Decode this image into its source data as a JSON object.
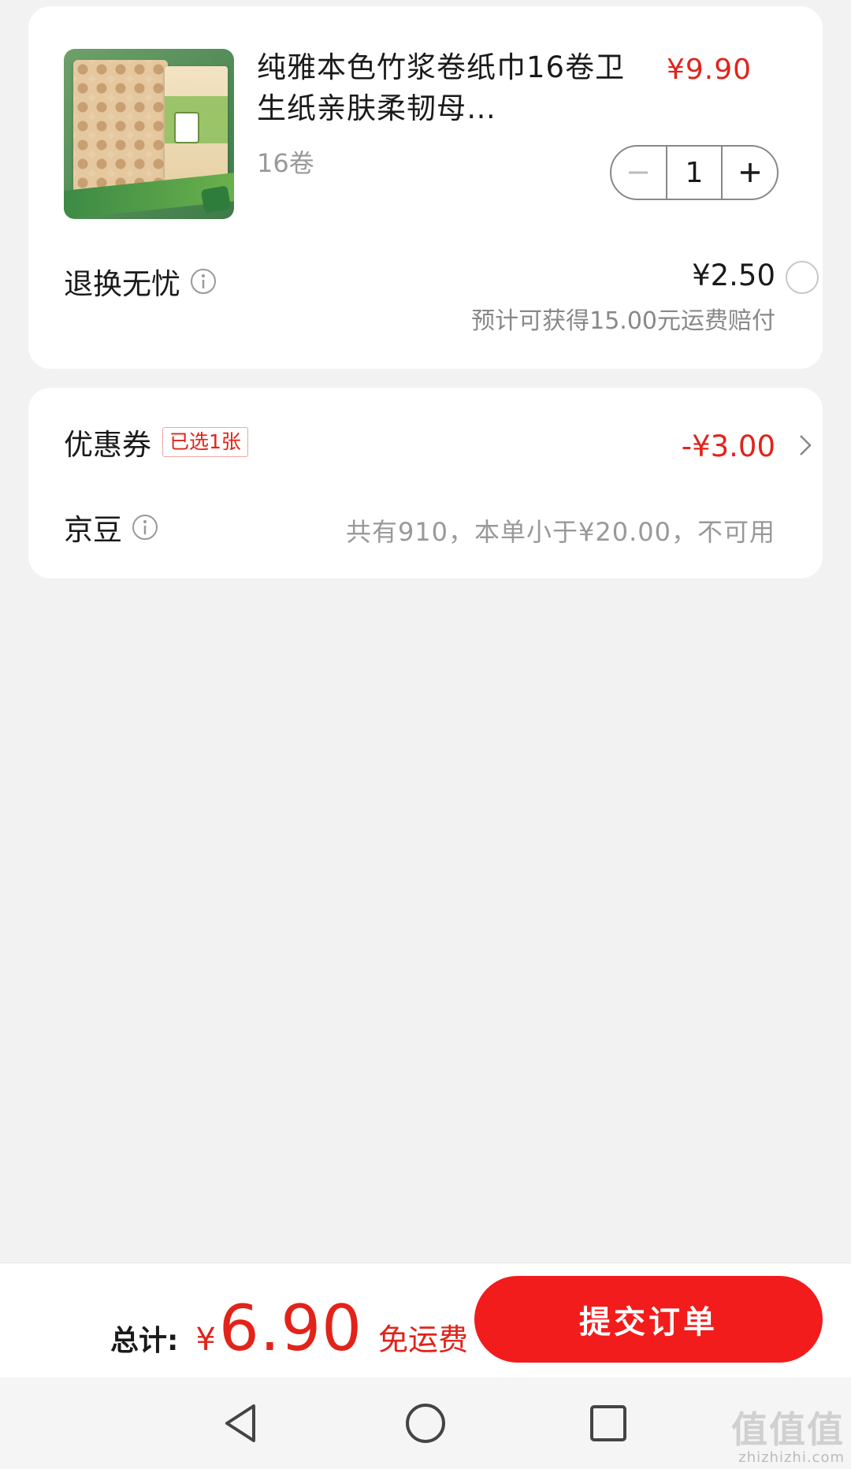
{
  "product": {
    "title": "纯雅本色竹浆卷纸巾16卷卫生纸亲肤柔韧母…",
    "spec": "16卷",
    "price": "¥9.90",
    "quantity": "1",
    "thumbnail_icon": "toilet-paper-product-image"
  },
  "return_service": {
    "label": "退换无忧",
    "price": "¥2.50",
    "note": "预计可获得15.00元运费赔付",
    "selected": false
  },
  "coupon": {
    "label": "优惠券",
    "tag": "已选1张",
    "amount": "-¥3.00"
  },
  "beans": {
    "label": "京豆",
    "note": "共有910，本单小于¥20.00，不可用"
  },
  "checkout": {
    "total_label": "总计:",
    "currency": "¥",
    "total_value": "6.90",
    "shipping_note": "免运费",
    "submit_label": "提交订单"
  },
  "watermark": {
    "logo": "值值值",
    "url": "zhizhizhi.com"
  },
  "colors": {
    "accent_red": "#e2231a",
    "button_red": "#f21c1c",
    "background": "#f2f2f2",
    "card": "#ffffff"
  }
}
